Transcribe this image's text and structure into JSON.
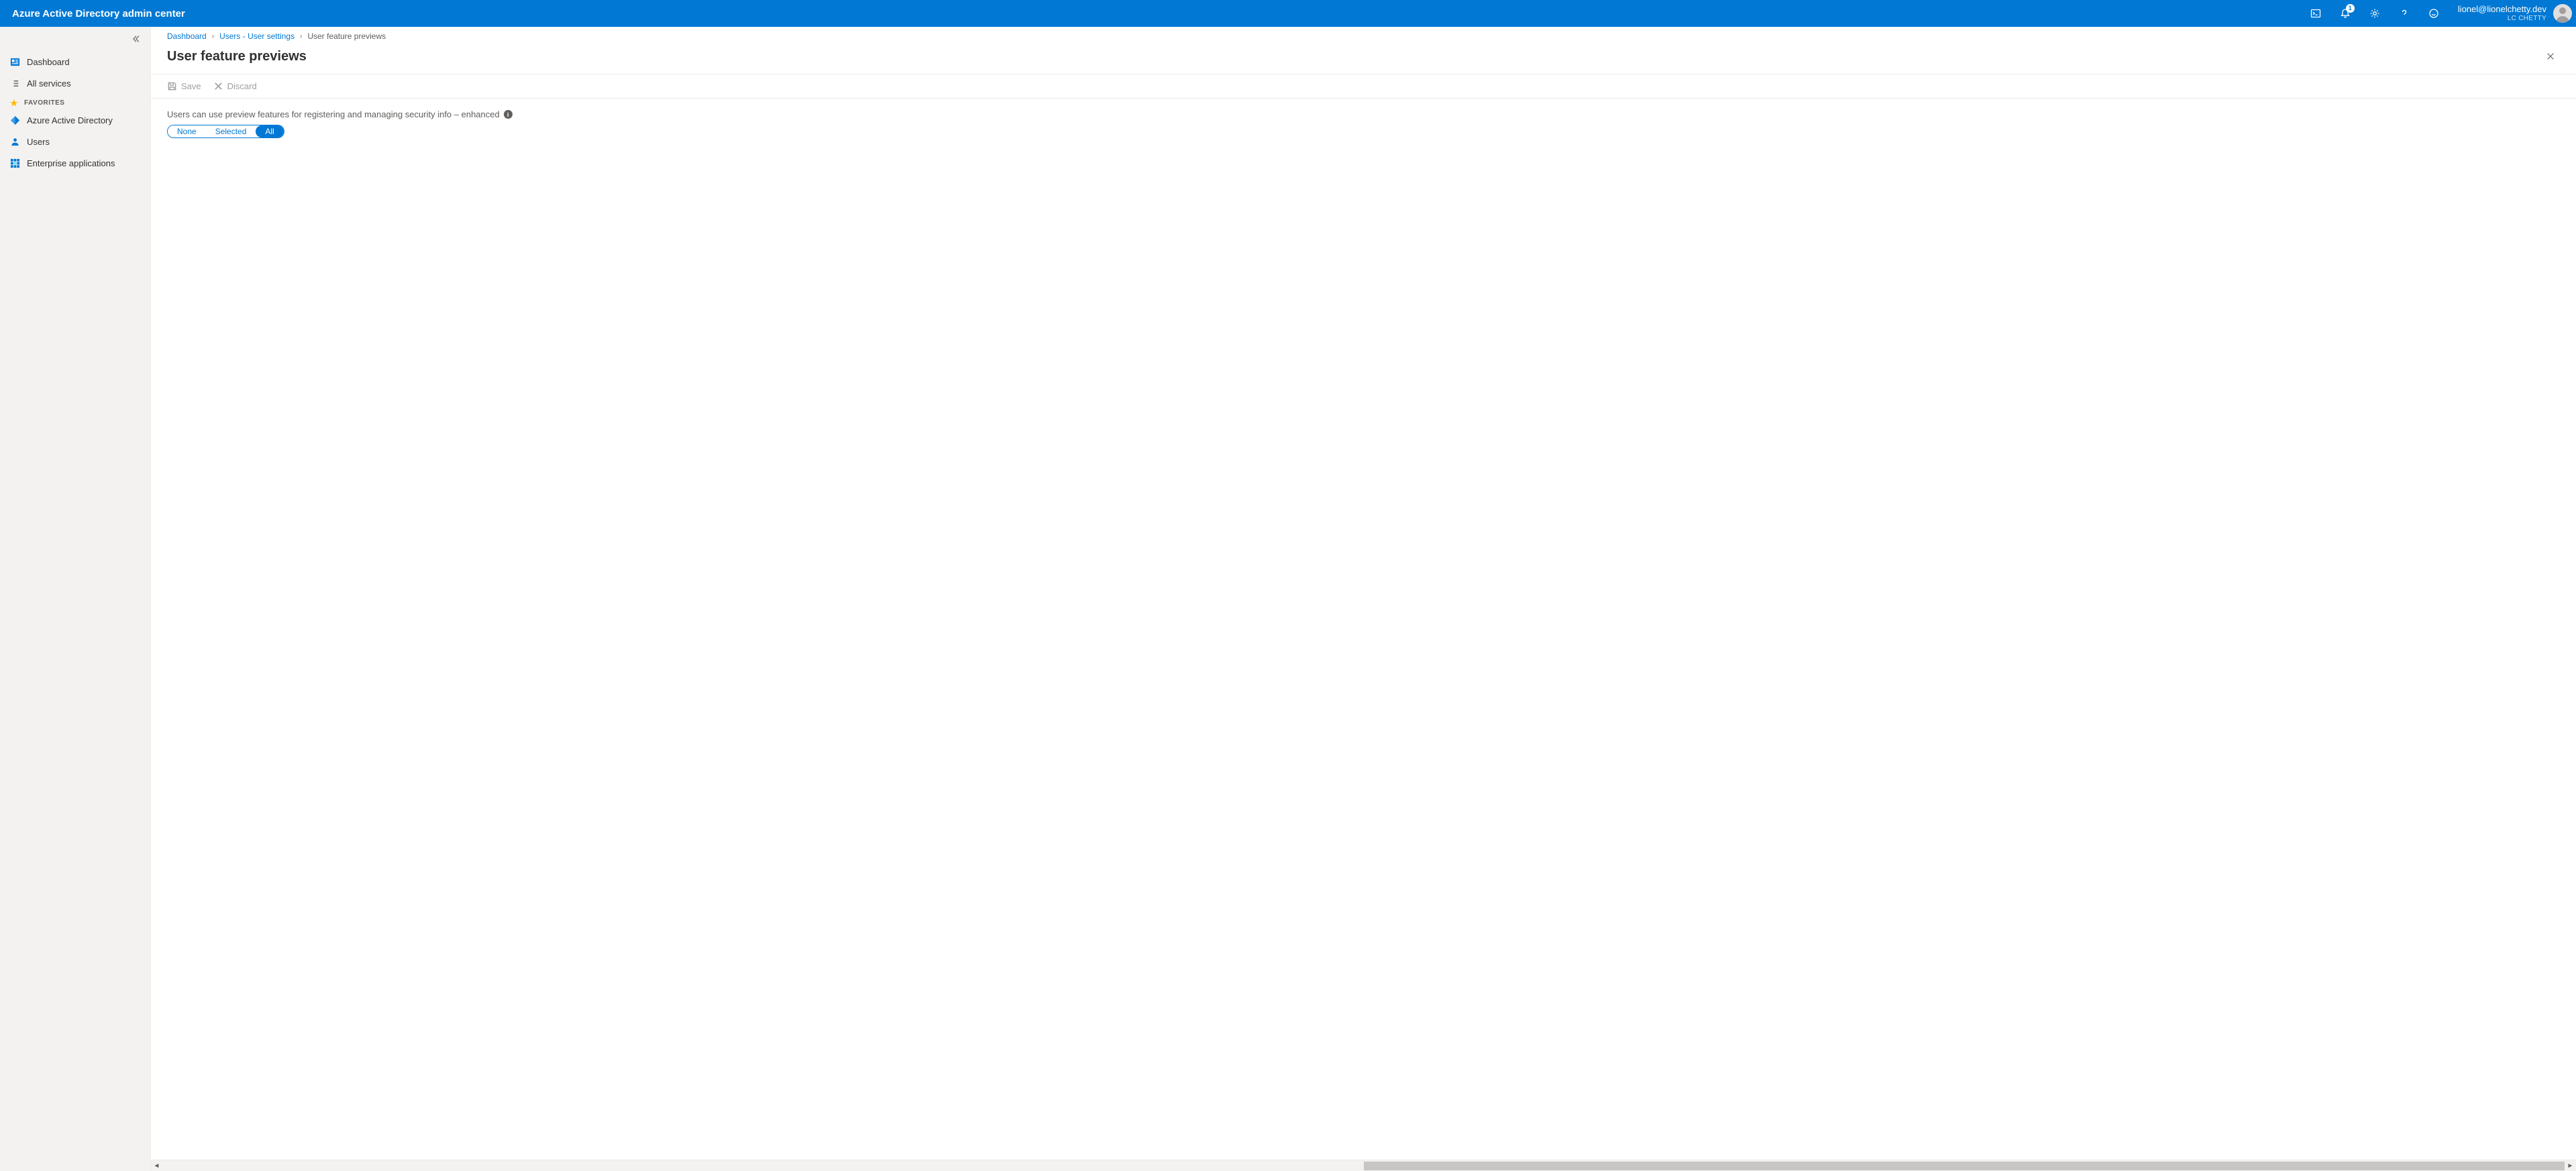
{
  "header": {
    "title": "Azure Active Directory admin center",
    "notification_count": "1",
    "user_email": "lionel@lionelchetty.dev",
    "user_org": "LC CHETTY"
  },
  "sidebar": {
    "items": [
      {
        "label": "Dashboard"
      },
      {
        "label": "All services"
      }
    ],
    "favorites_label": "FAVORITES",
    "favorites": [
      {
        "label": "Azure Active Directory"
      },
      {
        "label": "Users"
      },
      {
        "label": "Enterprise applications"
      }
    ]
  },
  "breadcrumb": {
    "items": [
      {
        "label": "Dashboard",
        "link": true
      },
      {
        "label": "Users - User settings",
        "link": true
      },
      {
        "label": "User feature previews",
        "link": false
      }
    ]
  },
  "blade": {
    "title": "User feature previews",
    "toolbar": {
      "save": "Save",
      "discard": "Discard"
    },
    "setting_label": "Users can use preview features for registering and managing security info – enhanced",
    "segmented": {
      "none": "None",
      "selected": "Selected",
      "all": "All",
      "value": "All"
    }
  }
}
